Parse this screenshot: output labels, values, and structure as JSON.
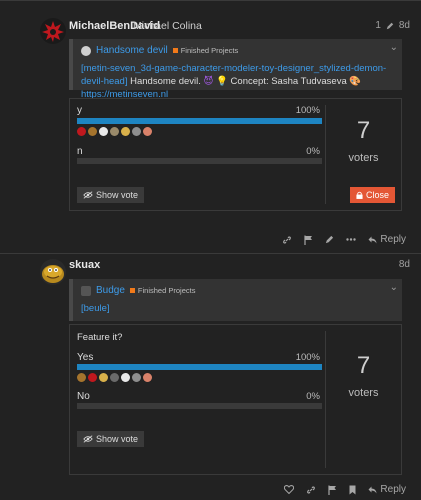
{
  "posts": [
    {
      "username": "MichaelBenDavid",
      "fullname": "Michael Colina",
      "edit_count": "1",
      "age": "8d",
      "quote": {
        "user": "Handsome devil",
        "category": "Finished Projects",
        "link_text": "[metin-seven_3d-game-character-modeler-toy-designer_stylized-demon-devil-head]",
        "text1": " Handsome devil. ",
        "text2": " Concept: Sasha Tudvaseva ",
        "url_text": "https://metinseven.nl"
      },
      "poll": {
        "options": [
          {
            "label": "y",
            "percent": "100%",
            "fraction": 1.0
          },
          {
            "label": "n",
            "percent": "0%",
            "fraction": 0.0
          }
        ],
        "voters_count": "7",
        "voters_label": "voters",
        "show_vote_label": "Show vote",
        "close_label": "Close"
      },
      "reply_label": "Reply"
    },
    {
      "username": "skuax",
      "age": "8d",
      "quote": {
        "user": "Budge",
        "category": "Finished Projects",
        "link_text": "[beule]"
      },
      "poll": {
        "question": "Feature it?",
        "options": [
          {
            "label": "Yes",
            "percent": "100%",
            "fraction": 1.0
          },
          {
            "label": "No",
            "percent": "0%",
            "fraction": 0.0
          }
        ],
        "voters_count": "7",
        "voters_label": "voters",
        "show_vote_label": "Show vote"
      },
      "reply_label": "Reply"
    }
  ],
  "colors": {
    "background": "#222222",
    "link": "#3d9be9",
    "bar": "#1e85c2",
    "close_button": "#e45735",
    "category": "#f27a1a"
  }
}
